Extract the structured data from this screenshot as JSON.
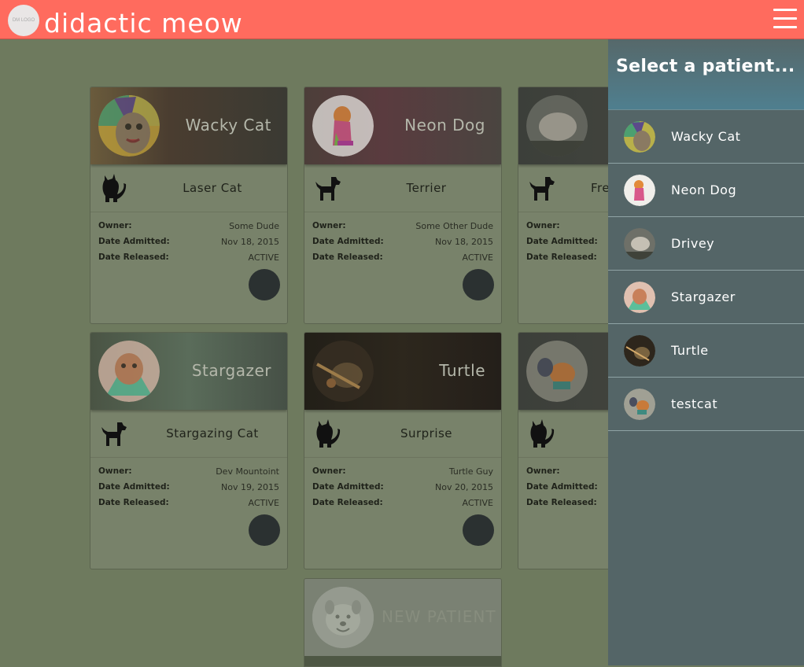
{
  "app": {
    "title": "didactic meow",
    "logo_text": "DM LOGO"
  },
  "drawer": {
    "title": "Select a patient...",
    "patients": [
      {
        "name": "Wacky Cat"
      },
      {
        "name": "Neon Dog"
      },
      {
        "name": "Drivey"
      },
      {
        "name": "Stargazer"
      },
      {
        "name": "Turtle"
      },
      {
        "name": "testcat"
      }
    ]
  },
  "labels": {
    "owner": "Owner:",
    "admitted": "Date Admitted:",
    "released": "Date Released:"
  },
  "cards": [
    {
      "name": "Wacky Cat",
      "species_icon": "cat-icon",
      "breed": "Laser Cat",
      "owner": "Some Dude",
      "admitted": "Nov 18, 2015",
      "released": "ACTIVE"
    },
    {
      "name": "Neon Dog",
      "species_icon": "dog-icon",
      "breed": "Terrier",
      "owner": "Some Other Dude",
      "admitted": "Nov 18, 2015",
      "released": "ACTIVE"
    },
    {
      "name": "",
      "species_icon": "dog-icon",
      "breed": "Fre",
      "owner": "",
      "admitted": "",
      "released": ""
    },
    {
      "name": "Stargazer",
      "species_icon": "dog-icon",
      "breed": "Stargazing Cat",
      "owner": "Dev Mountoint",
      "admitted": "Nov 19, 2015",
      "released": "ACTIVE"
    },
    {
      "name": "Turtle",
      "species_icon": "cat-icon",
      "breed": "Surprise",
      "owner": "Turtle Guy",
      "admitted": "Nov 20, 2015",
      "released": "ACTIVE"
    },
    {
      "name": "",
      "species_icon": "cat-icon",
      "breed": "",
      "owner": "",
      "admitted": "",
      "released": ""
    }
  ],
  "new_patient": {
    "label": "NEW PATIENT"
  }
}
